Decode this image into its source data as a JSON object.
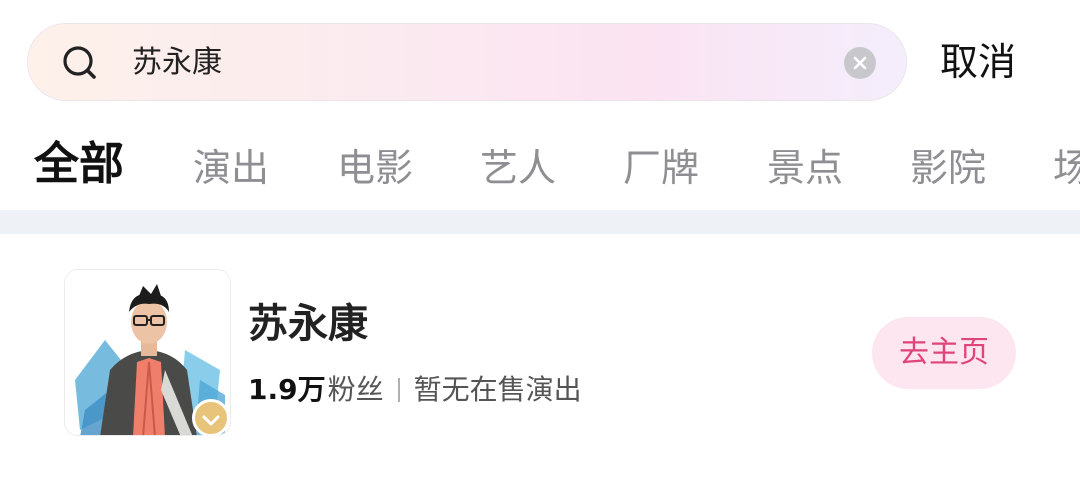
{
  "search": {
    "query": "苏永康",
    "cancel_label": "取消"
  },
  "tabs": [
    {
      "label": "全部",
      "active": true
    },
    {
      "label": "演出",
      "active": false
    },
    {
      "label": "电影",
      "active": false
    },
    {
      "label": "艺人",
      "active": false
    },
    {
      "label": "厂牌",
      "active": false
    },
    {
      "label": "景点",
      "active": false
    },
    {
      "label": "影院",
      "active": false
    },
    {
      "label": "场",
      "active": false
    }
  ],
  "result": {
    "name": "苏永康",
    "fans_count": "1.9万",
    "fans_label": "粉丝",
    "show_status": "暂无在售演出",
    "action_label": "去主页"
  },
  "colors": {
    "accent": "#e0447a",
    "accent_bg": "#fde6ef",
    "badge": "#e8c47a"
  }
}
